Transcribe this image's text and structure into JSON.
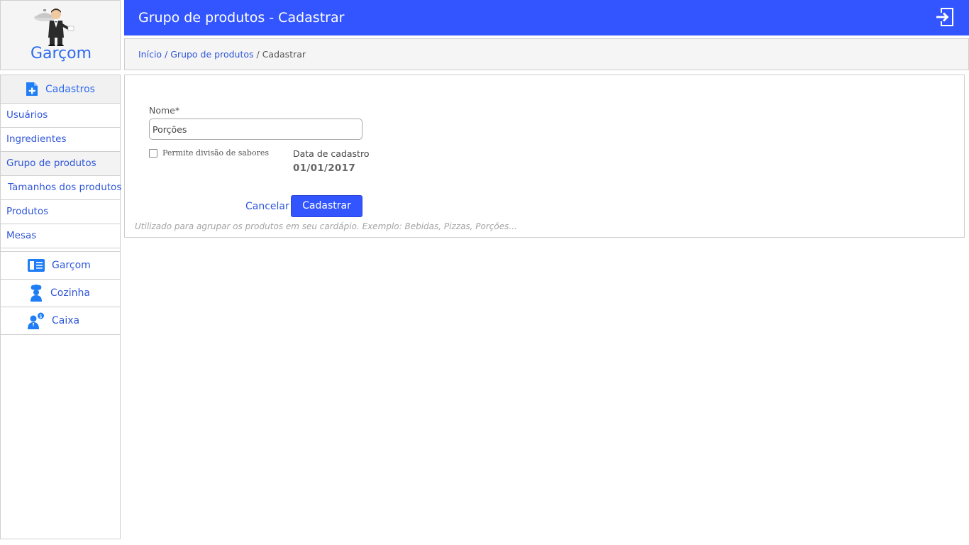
{
  "app": {
    "logo_text": "Garçom"
  },
  "header": {
    "title": "Grupo de produtos - Cadastrar",
    "exit_icon": "exit-icon"
  },
  "breadcrumb": {
    "home": "Início",
    "sep1": " / ",
    "parent": "Grupo de produtos",
    "sep2": " / ",
    "current": "Cadastrar"
  },
  "sidebar": {
    "section": {
      "label": "Cadastros",
      "icon": "add-document-icon"
    },
    "items": [
      {
        "label": "Usuários"
      },
      {
        "label": "Ingredientes"
      },
      {
        "label": "Grupo de produtos",
        "active": true
      },
      {
        "label": "Tamanhos dos produtos"
      },
      {
        "label": "Produtos"
      },
      {
        "label": "Mesas"
      }
    ],
    "modules": [
      {
        "label": "Garçom",
        "icon": "menu-book-icon"
      },
      {
        "label": "Cozinha",
        "icon": "chef-icon"
      },
      {
        "label": "Caixa",
        "icon": "cashier-icon"
      }
    ]
  },
  "form": {
    "nome_label": "Nome*",
    "nome_value": "Porções",
    "checkbox_label": "Permite divisão de sabores",
    "checkbox_checked": false,
    "data_label": "Data de cadastro",
    "data_value": "01/01/2017",
    "cancel_label": "Cancelar",
    "submit_label": "Cadastrar",
    "hint": "Utilizado para agrupar os produtos em seu cardápio. Exemplo: Bebidas, Pizzas, Porções..."
  },
  "colors": {
    "primary": "#3355ff",
    "link": "#2f56d9",
    "panel_bg": "#f5f5f5",
    "border": "#cfcfcf"
  }
}
